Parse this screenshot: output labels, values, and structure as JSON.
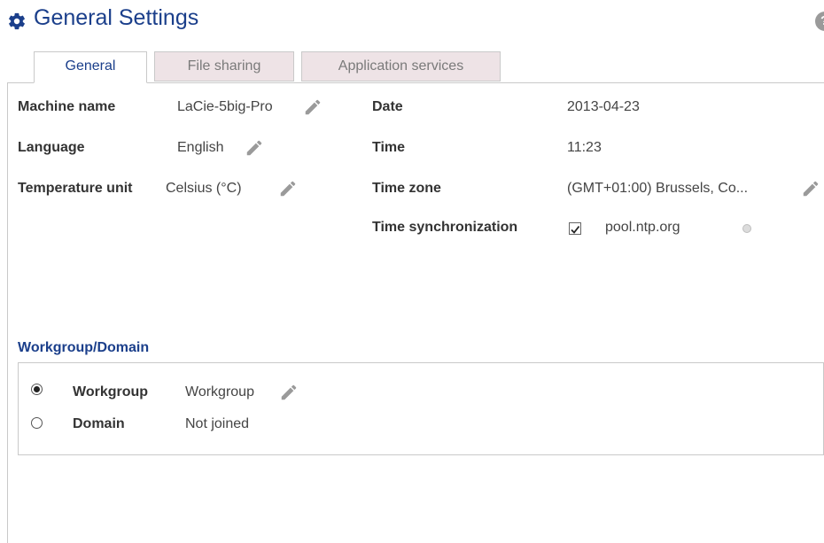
{
  "header": {
    "title": "General Settings",
    "icon": "gear-icon",
    "help_label": "?"
  },
  "tabs": [
    {
      "label": "General",
      "active": true
    },
    {
      "label": "File sharing",
      "active": false
    },
    {
      "label": "Application services",
      "active": false
    }
  ],
  "general": {
    "machine_name": {
      "label": "Machine name",
      "value": "LaCie-5big-Pro"
    },
    "language": {
      "label": "Language",
      "value": "English"
    },
    "temperature_unit": {
      "label": "Temperature unit",
      "value": "Celsius (°C)"
    },
    "date": {
      "label": "Date",
      "value": "2013-04-23"
    },
    "time": {
      "label": "Time",
      "value": "11:23"
    },
    "time_zone": {
      "label": "Time zone",
      "value": "(GMT+01:00) Brussels, Co..."
    },
    "time_sync": {
      "label": "Time synchronization",
      "checked": true,
      "server": "pool.ntp.org",
      "status": "inactive"
    }
  },
  "workgroup_domain": {
    "title": "Workgroup/Domain",
    "options": [
      {
        "label": "Workgroup",
        "value": "Workgroup",
        "selected": true
      },
      {
        "label": "Domain",
        "value": "Not joined",
        "selected": false
      }
    ]
  },
  "colors": {
    "accent": "#1b3f8b",
    "inactive_tab": "#eee3e6",
    "border": "#c9c9c9",
    "icon_gray": "#9a9a9a"
  }
}
